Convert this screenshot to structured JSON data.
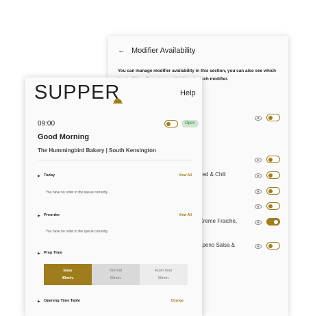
{
  "modifier_panel": {
    "title": "Modifier Availability",
    "description": "You can manage modifier availability in this section, you can also see which food will be affected by availability of which modifier.",
    "rows": [
      {
        "label": "",
        "on": false
      },
      {
        "label": "",
        "on": false
      },
      {
        "label": "eed & Chili",
        "on": false
      },
      {
        "label": "",
        "on": false
      },
      {
        "label": "",
        "on": false
      },
      {
        "label": "Creme Fraiche,",
        "on": true
      },
      {
        "label": "apeno Salsa &",
        "on": false
      }
    ]
  },
  "home": {
    "logo": "SUPPER",
    "help": "Help",
    "time": "09:00",
    "open_badge": "Open",
    "greeting": "Good Morning",
    "store": "The Hummingbird Bakery | South Kensington",
    "today": {
      "label": "Today",
      "link": "View All",
      "empty": "You have no order in the queue currently."
    },
    "preorder": {
      "label": "Preorder",
      "link": "View All",
      "empty": "You have no order in the queue currently."
    },
    "prep": {
      "label": "Prep Time",
      "options": [
        {
          "name": "Easy",
          "time": "40min."
        },
        {
          "name": "Normal",
          "time": "60min."
        },
        {
          "name": "Rush hour",
          "time": "90min."
        }
      ]
    },
    "opening": {
      "label": "Opening Time Table",
      "link": "Change"
    }
  },
  "colors": {
    "accent": "#a07d1c",
    "badge_bg": "#cfe6cf"
  }
}
